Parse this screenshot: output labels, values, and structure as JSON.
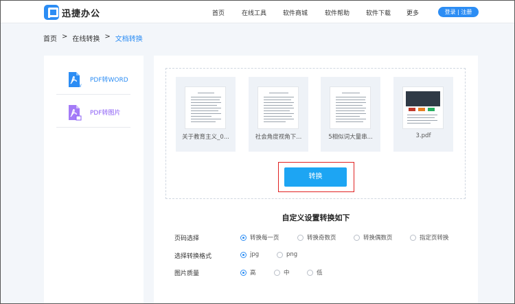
{
  "header": {
    "logo_text": "迅捷办公",
    "nav": [
      "首页",
      "在线工具",
      "软件商城",
      "软件帮助",
      "软件下载",
      "更多"
    ],
    "login_label": "登录 | 注册"
  },
  "breadcrumb": {
    "items": [
      "首页",
      ">",
      "在线转换",
      ">",
      "文档转换"
    ]
  },
  "sidebar": {
    "items": [
      {
        "label": "PDF转WORD",
        "icon": "pdf-to-word-icon"
      },
      {
        "label": "PDF转图片",
        "icon": "pdf-to-image-icon"
      }
    ]
  },
  "files": [
    {
      "name": "关于教育主义_0..."
    },
    {
      "name": "社会角度视角下..."
    },
    {
      "name": "5相似词大量串..."
    },
    {
      "name": "3.pdf"
    }
  ],
  "convert_label": "转换",
  "settings": {
    "title": "自定义设置转换如下",
    "page_label": "页码选择",
    "page_options": [
      "转换每一页",
      "转换奇数页",
      "转换偶数页",
      "指定页转换"
    ],
    "page_selected": "转换每一页",
    "format_label": "选择转换格式",
    "format_options": [
      "jpg",
      "png"
    ],
    "format_selected": "jpg",
    "quality_label": "图片质量",
    "quality_options": [
      "高",
      "中",
      "低"
    ],
    "quality_selected": "高"
  },
  "colors": {
    "accent": "#2c8df4",
    "convert_button": "#1da5f3",
    "highlight_border": "#e02020"
  }
}
